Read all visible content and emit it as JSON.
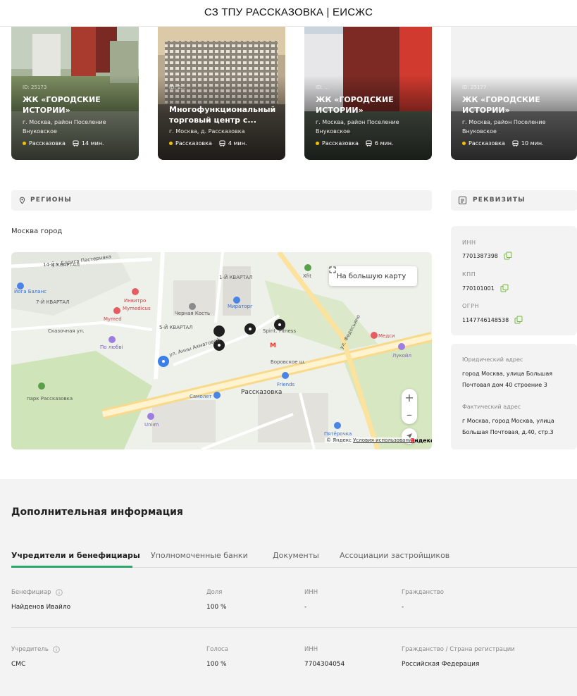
{
  "header": {
    "title": "СЗ ТПУ РАССКАЗОВКА | ЕИСЖС"
  },
  "cards": [
    {
      "id": "ID: 25173",
      "name": "ЖК «ГОРОДСКИЕ ИСТОРИИ»",
      "address": "г. Москва, район Поселение Внуковское",
      "station": "Рассказовка",
      "time": "14 мин."
    },
    {
      "id": "ID: 2...",
      "name": "Многофункциональный торговый центр с...",
      "address": "г. Москва, д. Рассказовка",
      "station": "Рассказовка",
      "time": "4 мин."
    },
    {
      "id": "ID: ...",
      "name": "ЖК «ГОРОДСКИЕ ИСТОРИИ»",
      "address": "г. Москва, район Поселение Внуковское",
      "station": "Рассказовка",
      "time": "6 мин."
    },
    {
      "id": "ID: 25177",
      "name": "ЖК «ГОРОДСКИЕ ИСТОРИИ»",
      "address": "г. Москва, район Поселение Внуковское",
      "station": "Рассказовка",
      "time": "10 мин."
    }
  ],
  "regions": {
    "title": "Регионы",
    "value": "Москва город"
  },
  "map": {
    "big_map_label": "На большую карту",
    "zoom_in": "+",
    "zoom_out": "–",
    "copyright": "© Яндекс",
    "terms": "Условия использования",
    "logo_prefix": "Я",
    "logo_suffix": "ндекс",
    "labels": {
      "kvartal14": "14-Й КВАРТАЛ",
      "kvartal7": "7-Й КВАРТАЛ",
      "kvartal1": "1-Й КВАРТАЛ",
      "kvartal5": "5-Й КВАРТАЛ",
      "yoga": "Йога Баланс",
      "mymedicus": "Mymedicus",
      "mymed": "Mymed",
      "invitro": "Инвитро",
      "chernaya": "Черная Кость",
      "miratorg": "Мираторг",
      "spirit": "Spirit. Fitness",
      "medsi": "Медси",
      "lukoil": "Лукойл",
      "polyubvi": "По любві",
      "park": "парк Рассказовка",
      "samolet": "Самолет",
      "friends": "Friends",
      "rasskazovka": "Рассказовка",
      "unim": "Uniım",
      "pyaterochka": "Пятёрочка",
      "borovskoe": "Боровское ш.",
      "fedosyino": "ул. Федосьино",
      "akhmatovoy": "ул. Анны Ахматовой",
      "pasternaka": "ул. Бориса Пастернака",
      "skazochnaya": "Сказочная ул.",
      "xfit": "Xfit"
    }
  },
  "requisites": {
    "title": "Реквизиты",
    "inn_label": "ИНН",
    "inn": "7701387398",
    "kpp_label": "КПП",
    "kpp": "770101001",
    "ogrn_label": "ОГРН",
    "ogrn": "1147746148538",
    "legal_label": "Юридический адрес",
    "legal": "город Москва, улица Большая Почтовая дом 40 строение 3",
    "actual_label": "Фактический адрес",
    "actual": "г Москва, город Москва, улица Большая Почтовая, д.40, стр.3"
  },
  "extra": {
    "title": "Дополнительная информация",
    "tabs": [
      "Учредители и бенефициары",
      "Уполномоченные банки",
      "Документы",
      "Ассоциации застройщиков"
    ],
    "beneficiary": {
      "label": "Бенефициар",
      "value": "Найденов Ивайло",
      "share_label": "Доля",
      "share": "100 %",
      "inn_label": "ИНН",
      "inn": "-",
      "citizenship_label": "Гражданство",
      "citizenship": "-"
    },
    "founder": {
      "label": "Учредитель",
      "value": "СМС",
      "votes_label": "Голоса",
      "votes": "100 %",
      "inn_label": "ИНН",
      "inn": "7704304054",
      "country_label": "Гражданство / Страна регистрации",
      "country": "Российская Федерация"
    }
  },
  "colors": {
    "accent": "#2ea86a",
    "station_dot": "#f2c200"
  }
}
